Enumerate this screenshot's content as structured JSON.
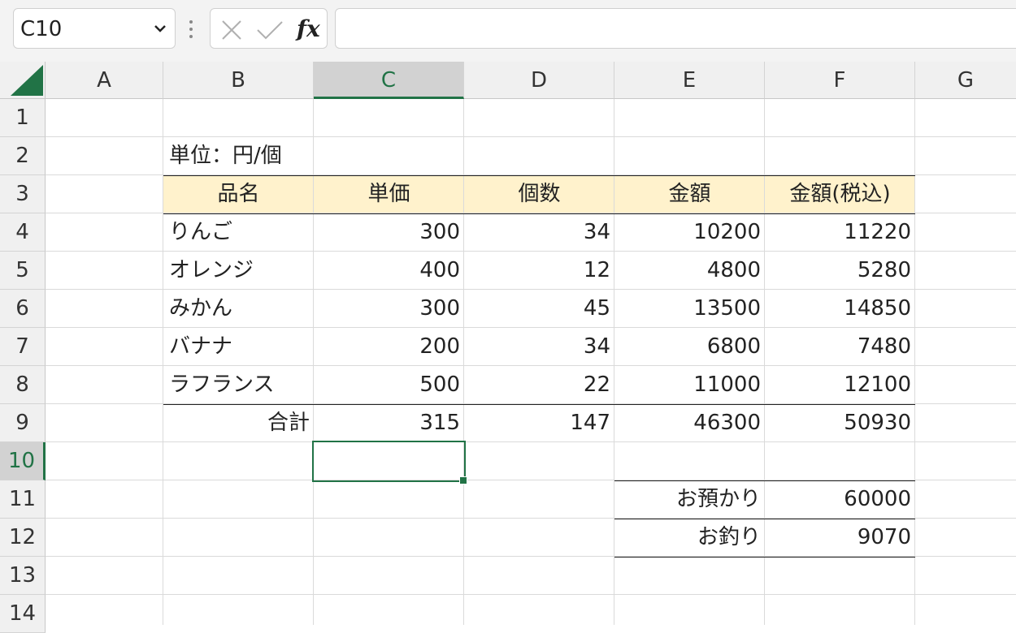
{
  "formula_bar": {
    "name_box": "C10",
    "cancel_icon": "close-icon",
    "enter_icon": "check-icon",
    "fx_label": "fx",
    "formula": ""
  },
  "columns": [
    "A",
    "B",
    "C",
    "D",
    "E",
    "F",
    "G"
  ],
  "rows": [
    "1",
    "2",
    "3",
    "4",
    "5",
    "6",
    "7",
    "8",
    "9",
    "10",
    "11",
    "12",
    "13",
    "14"
  ],
  "selected_cell": "C10",
  "colors": {
    "accent": "#217346",
    "header_fill": "#fff2cc",
    "selected_header": "#d2d2d2"
  },
  "sheet": {
    "unit_note": "単位：円/個",
    "table_headers": [
      "品名",
      "単価",
      "個数",
      "金額",
      "金額(税込)"
    ],
    "items": [
      {
        "name": "りんご",
        "price": "300",
        "qty": "34",
        "amount": "10200",
        "amount_tax": "11220"
      },
      {
        "name": "オレンジ",
        "price": "400",
        "qty": "12",
        "amount": "4800",
        "amount_tax": "5280"
      },
      {
        "name": "みかん",
        "price": "300",
        "qty": "45",
        "amount": "13500",
        "amount_tax": "14850"
      },
      {
        "name": "バナナ",
        "price": "200",
        "qty": "34",
        "amount": "6800",
        "amount_tax": "7480"
      },
      {
        "name": "ラフランス",
        "price": "500",
        "qty": "22",
        "amount": "11000",
        "amount_tax": "12100"
      }
    ],
    "total": {
      "label": "合計",
      "price": "315",
      "qty": "147",
      "amount": "46300",
      "amount_tax": "50930"
    },
    "payment": {
      "received_label": "お預かり",
      "received": "60000",
      "change_label": "お釣り",
      "change": "9070"
    }
  }
}
